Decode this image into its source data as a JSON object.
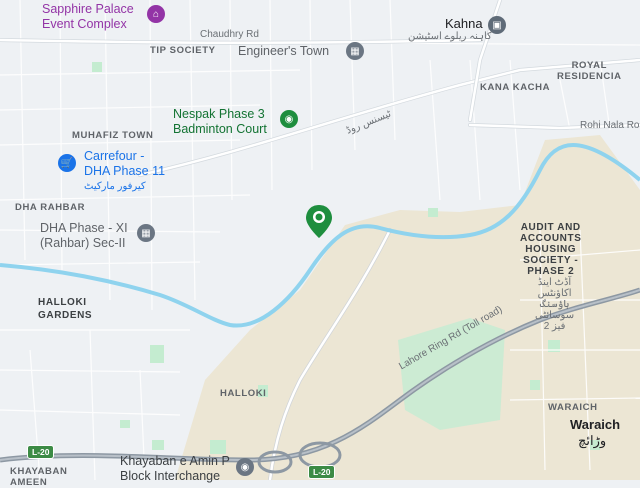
{
  "places": {
    "sapphire": {
      "line1": "Sapphire Palace",
      "line2": "Event Complex"
    },
    "chaudhry_rd": "Chaudhry Rd",
    "kahna": "Kahna",
    "kahna_urdu": "کاہنہ ریلوے اسٹیشن",
    "tip_society": "TIP SOCIETY",
    "engineers_town": "Engineer's Town",
    "royal_residencia": {
      "line1": "ROYAL",
      "line2": "RESIDENCIA"
    },
    "kana_kacha": "KANA KACHA",
    "nespak": {
      "line1": "Nespak Phase 3",
      "line2": "Badminton Court"
    },
    "urdu_road": "ٹیسنس روڈ",
    "rohi_nala": "Rohi Nala Ro",
    "muhafiz_town": "MUHAFIZ TOWN",
    "carrefour": {
      "line1": "Carrefour -",
      "line2": "DHA Phase 11",
      "line3": "کیرفور مارکیٹ"
    },
    "dha_rahbar": "DHA RAHBAR",
    "dha_phase": {
      "line1": "DHA Phase - XI",
      "line2": "(Rahbar) Sec-II"
    },
    "audit": {
      "line1": "AUDIT AND",
      "line2": "ACCOUNTS",
      "line3": "HOUSING",
      "line4": "SOCIETY -",
      "line5": "PHASE 2"
    },
    "audit_urdu": {
      "line1": "آڈٹ اینڈ",
      "line2": "اکاؤنٹس",
      "line3": "ہاؤسنگ",
      "line4": "سوسائٹی",
      "line5": "فیز 2"
    },
    "halloki_gardens": {
      "line1": "HALLOKI",
      "line2": "GARDENS"
    },
    "ring_road": "Lahore Ring Rd (Toll road)",
    "halloki": "HALLOKI",
    "waraich": "WARAICH",
    "waraich_town": "Waraich",
    "waraich_urdu": "وڑائچ",
    "khayaban_amin": {
      "line1": "Khayaban e Amin P",
      "line2": "Block Interchange"
    },
    "khayaban_left": {
      "line1": "KHAYABAN",
      "line2": "AMEEN"
    },
    "l20_a": "L-20",
    "l20_b": "L-20"
  },
  "icons": {
    "sapphire": "event-venue-icon",
    "kahna": "train-station-icon",
    "engineers": "landmark-icon",
    "nespak": "sports-icon",
    "carrefour": "shopping-cart-icon",
    "dha": "landmark-icon",
    "khayaban": "place-pin-icon",
    "marker": "selected-location-pin-icon"
  },
  "colors": {
    "land": "#eef1f4",
    "block": "#e3e8ec",
    "street": "#ffffff",
    "road_edge": "#cfd6dc",
    "river": "#8fd3ee",
    "sand": "#ece6d4",
    "park": "#c4ecd0",
    "motorway": "#8d98a3",
    "pin": "#1e8e3e",
    "purple": "#9334a6",
    "gray_poi": "#6b7683",
    "blue_poi": "#1a73e8"
  }
}
